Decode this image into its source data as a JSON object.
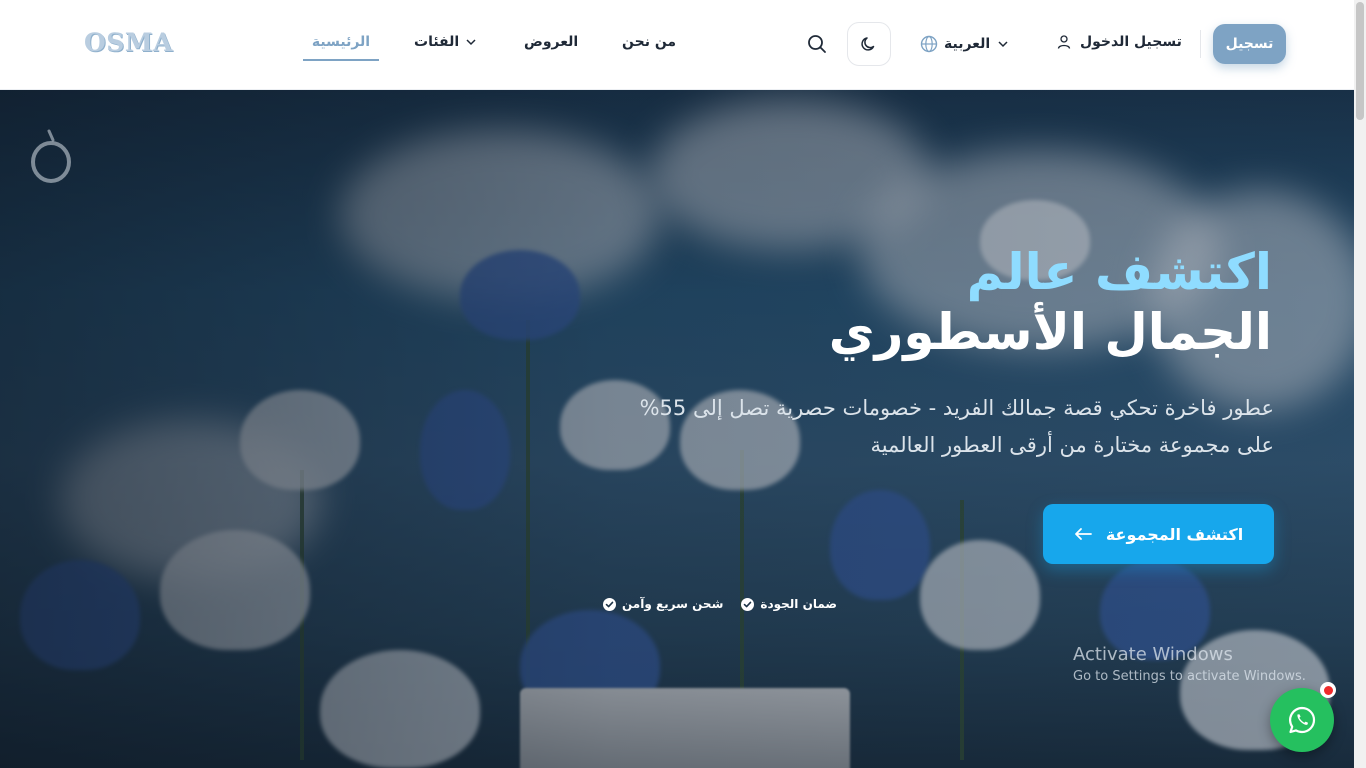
{
  "brand": {
    "logo_text": "OSMA"
  },
  "nav": {
    "home": "الرئيسية",
    "categories": "الفئات",
    "offers": "العروض",
    "about": "من نحن"
  },
  "header": {
    "language": "العربية",
    "login": "تسجيل الدخول",
    "register": "تسجيل"
  },
  "hero": {
    "title_line1": "اكتشف عالم",
    "title_line2": "الجمال الأسطوري",
    "subtitle": "عطور فاخرة تحكي قصة جمالك الفريد - خصومات حصرية تصل إلى 55% على مجموعة مختارة من أرقى العطور العالمية",
    "cta": "اكتشف المجموعة",
    "badges": [
      "ضمان الجودة",
      "شحن سريع وآمن"
    ]
  },
  "watermark": {
    "line1": "Activate Windows",
    "line2": "Go to Settings to activate Windows."
  },
  "colors": {
    "accent": "#7ea3c4",
    "cta": "#17a7ec",
    "title_highlight": "#8fdcff",
    "whatsapp": "#25c05f"
  },
  "icons": [
    "search-icon",
    "moon-icon",
    "globe-icon",
    "chevron-down-icon",
    "user-icon",
    "arrow-left-icon",
    "check-circle-icon",
    "whatsapp-icon"
  ]
}
